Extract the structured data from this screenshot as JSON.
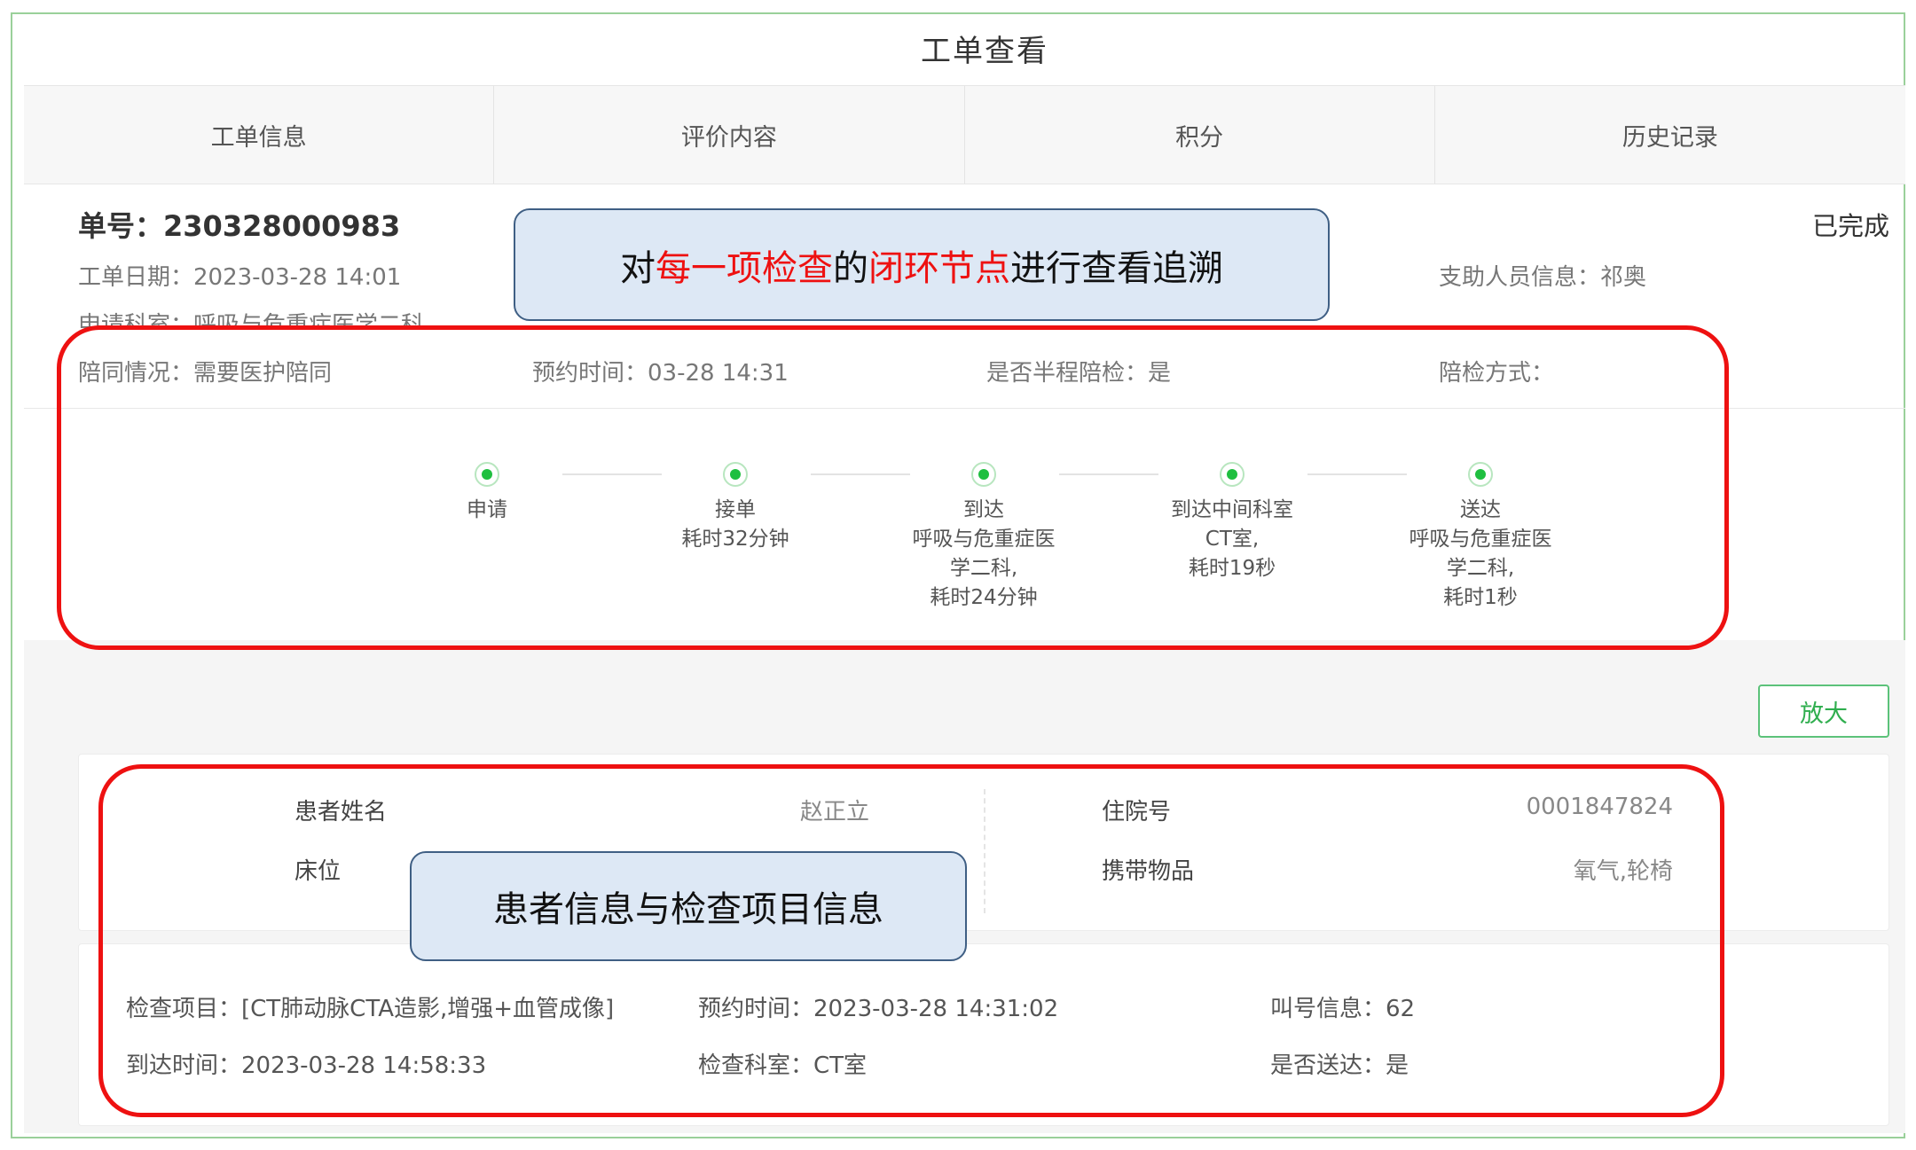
{
  "title": "工单查看",
  "tabs": [
    "工单信息",
    "评价内容",
    "积分",
    "历史记录"
  ],
  "order": {
    "number_label": "单号：",
    "number": "230328000983",
    "status": "已完成",
    "date": "工单日期：2023-03-28 14:01",
    "dept": "申请科室：呼吸与危重症医学二科",
    "helper": "支助人员信息：祁奥",
    "escort": "陪同情况：需要医护陪同",
    "appointment": "预约时间：03-28 14:31",
    "half_escort": "是否半程陪检：是",
    "escort_mode": "陪检方式："
  },
  "steps": [
    {
      "label": "申请",
      "desc": ""
    },
    {
      "label": "接单",
      "desc": "耗时32分钟"
    },
    {
      "label": "到达",
      "desc": "呼吸与危重症医\n学二科,\n耗时24分钟"
    },
    {
      "label": "到达中间科室",
      "desc": "CT室,\n耗时19秒"
    },
    {
      "label": "送达",
      "desc": "呼吸与危重症医\n学二科,\n耗时1秒"
    }
  ],
  "zoom_button": "放大",
  "patient": {
    "name_label": "患者姓名",
    "name": "赵正立",
    "hosp_label": "住院号",
    "hosp_no": "0001847824",
    "bed_label": "床位",
    "items_label": "携带物品",
    "items": "氧气,轮椅"
  },
  "exam": {
    "item": "检查项目：[CT肺动脉CTA造影,增强+血管成像]",
    "appt": "预约时间：2023-03-28 14:31:02",
    "call": "叫号信息：62",
    "arrive": "到达时间：2023-03-28 14:58:33",
    "room": "检查科室：CT室",
    "delivered": "是否送达：是"
  },
  "callouts": {
    "top_pre": "对",
    "top_hl1": "每一项检查",
    "top_mid": "的",
    "top_hl2": "闭环节点",
    "top_post": "进行查看追溯",
    "bottom": "患者信息与检查项目信息"
  },
  "colors": {
    "accent_green": "#1fbf40",
    "annotation_red": "#ee1111",
    "callout_fill": "#dde8f5"
  }
}
